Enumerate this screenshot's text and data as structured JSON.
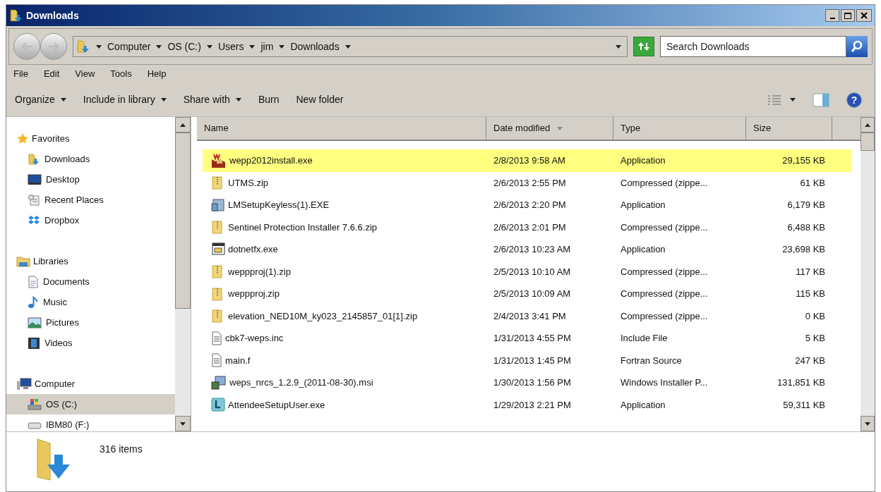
{
  "window": {
    "title": "Downloads"
  },
  "address": {
    "crumbs": [
      "Computer",
      "OS (C:)",
      "Users",
      "jim",
      "Downloads"
    ]
  },
  "search": {
    "placeholder": "Search Downloads"
  },
  "menu": [
    "File",
    "Edit",
    "View",
    "Tools",
    "Help"
  ],
  "toolbar": [
    {
      "label": "Organize",
      "dropdown": true
    },
    {
      "label": "Include in library",
      "dropdown": true
    },
    {
      "label": "Share with",
      "dropdown": true
    },
    {
      "label": "Burn",
      "dropdown": false
    },
    {
      "label": "New folder",
      "dropdown": false
    }
  ],
  "help": {
    "label": "?"
  },
  "sidebar": {
    "groups": [
      {
        "label": "Favorites",
        "kind": "star",
        "children": [
          {
            "label": "Downloads",
            "kind": "downloads",
            "selected": false
          },
          {
            "label": "Desktop",
            "kind": "desktop",
            "selected": false
          },
          {
            "label": "Recent Places",
            "kind": "recent",
            "selected": false
          },
          {
            "label": "Dropbox",
            "kind": "dropbox",
            "selected": false
          }
        ]
      },
      {
        "label": "Libraries",
        "kind": "library",
        "children": [
          {
            "label": "Documents",
            "kind": "document",
            "selected": false
          },
          {
            "label": "Music",
            "kind": "music",
            "selected": false
          },
          {
            "label": "Pictures",
            "kind": "picture",
            "selected": false
          },
          {
            "label": "Videos",
            "kind": "video",
            "selected": false
          }
        ]
      },
      {
        "label": "Computer",
        "kind": "computer",
        "children": [
          {
            "label": "OS (C:)",
            "kind": "drive",
            "selected": true
          },
          {
            "label": "IBM80 (F:)",
            "kind": "disk",
            "selected": false
          }
        ]
      }
    ]
  },
  "table": {
    "columns": [
      {
        "label": "Name",
        "sorted": false
      },
      {
        "label": "Date modified",
        "sorted": true
      },
      {
        "label": "Type",
        "sorted": false
      },
      {
        "label": "Size",
        "sorted": false
      }
    ],
    "rows": [
      {
        "kind": "installer",
        "name": "wepp2012install.exe",
        "date": "2/8/2013 9:58 AM",
        "type": "Application",
        "size": "29,155 KB",
        "highlighted": true
      },
      {
        "kind": "zip",
        "name": "UTMS.zip",
        "date": "2/6/2013 2:55 PM",
        "type": "Compressed (zippe...",
        "size": "61 KB",
        "highlighted": false
      },
      {
        "kind": "setup",
        "name": "LMSetupKeyless(1).EXE",
        "date": "2/6/2013 2:20 PM",
        "type": "Application",
        "size": "6,179 KB",
        "highlighted": false
      },
      {
        "kind": "zip",
        "name": "Sentinel Protection Installer 7.6.6.zip",
        "date": "2/6/2013 2:01 PM",
        "type": "Compressed (zippe...",
        "size": "6,488 KB",
        "highlighted": false
      },
      {
        "kind": "window",
        "name": "dotnetfx.exe",
        "date": "2/6/2013 10:23 AM",
        "type": "Application",
        "size": "23,698 KB",
        "highlighted": false
      },
      {
        "kind": "zip",
        "name": "weppproj(1).zip",
        "date": "2/5/2013 10:10 AM",
        "type": "Compressed (zippe...",
        "size": "117 KB",
        "highlighted": false
      },
      {
        "kind": "zip",
        "name": "weppproj.zip",
        "date": "2/5/2013 10:09 AM",
        "type": "Compressed (zippe...",
        "size": "115 KB",
        "highlighted": false
      },
      {
        "kind": "zip",
        "name": "elevation_NED10M_ky023_2145857_01[1].zip",
        "date": "2/4/2013 3:41 PM",
        "type": "Compressed (zippe...",
        "size": "0 KB",
        "highlighted": false
      },
      {
        "kind": "text",
        "name": "cbk7-weps.inc",
        "date": "1/31/2013 4:55 PM",
        "type": "Include File",
        "size": "5 KB",
        "highlighted": false
      },
      {
        "kind": "text",
        "name": "main.f",
        "date": "1/31/2013 1:45 PM",
        "type": "Fortran Source",
        "size": "247 KB",
        "highlighted": false
      },
      {
        "kind": "msi",
        "name": "weps_nrcs_1.2.9_(2011-08-30).msi",
        "date": "1/30/2013 1:56 PM",
        "type": "Windows Installer P...",
        "size": "131,851 KB",
        "highlighted": false
      },
      {
        "kind": "app",
        "name": "AttendeeSetupUser.exe",
        "date": "1/29/2013 2:21 PM",
        "type": "Application",
        "size": "59,311 KB",
        "highlighted": false
      }
    ]
  },
  "details": {
    "count": "316 items"
  }
}
